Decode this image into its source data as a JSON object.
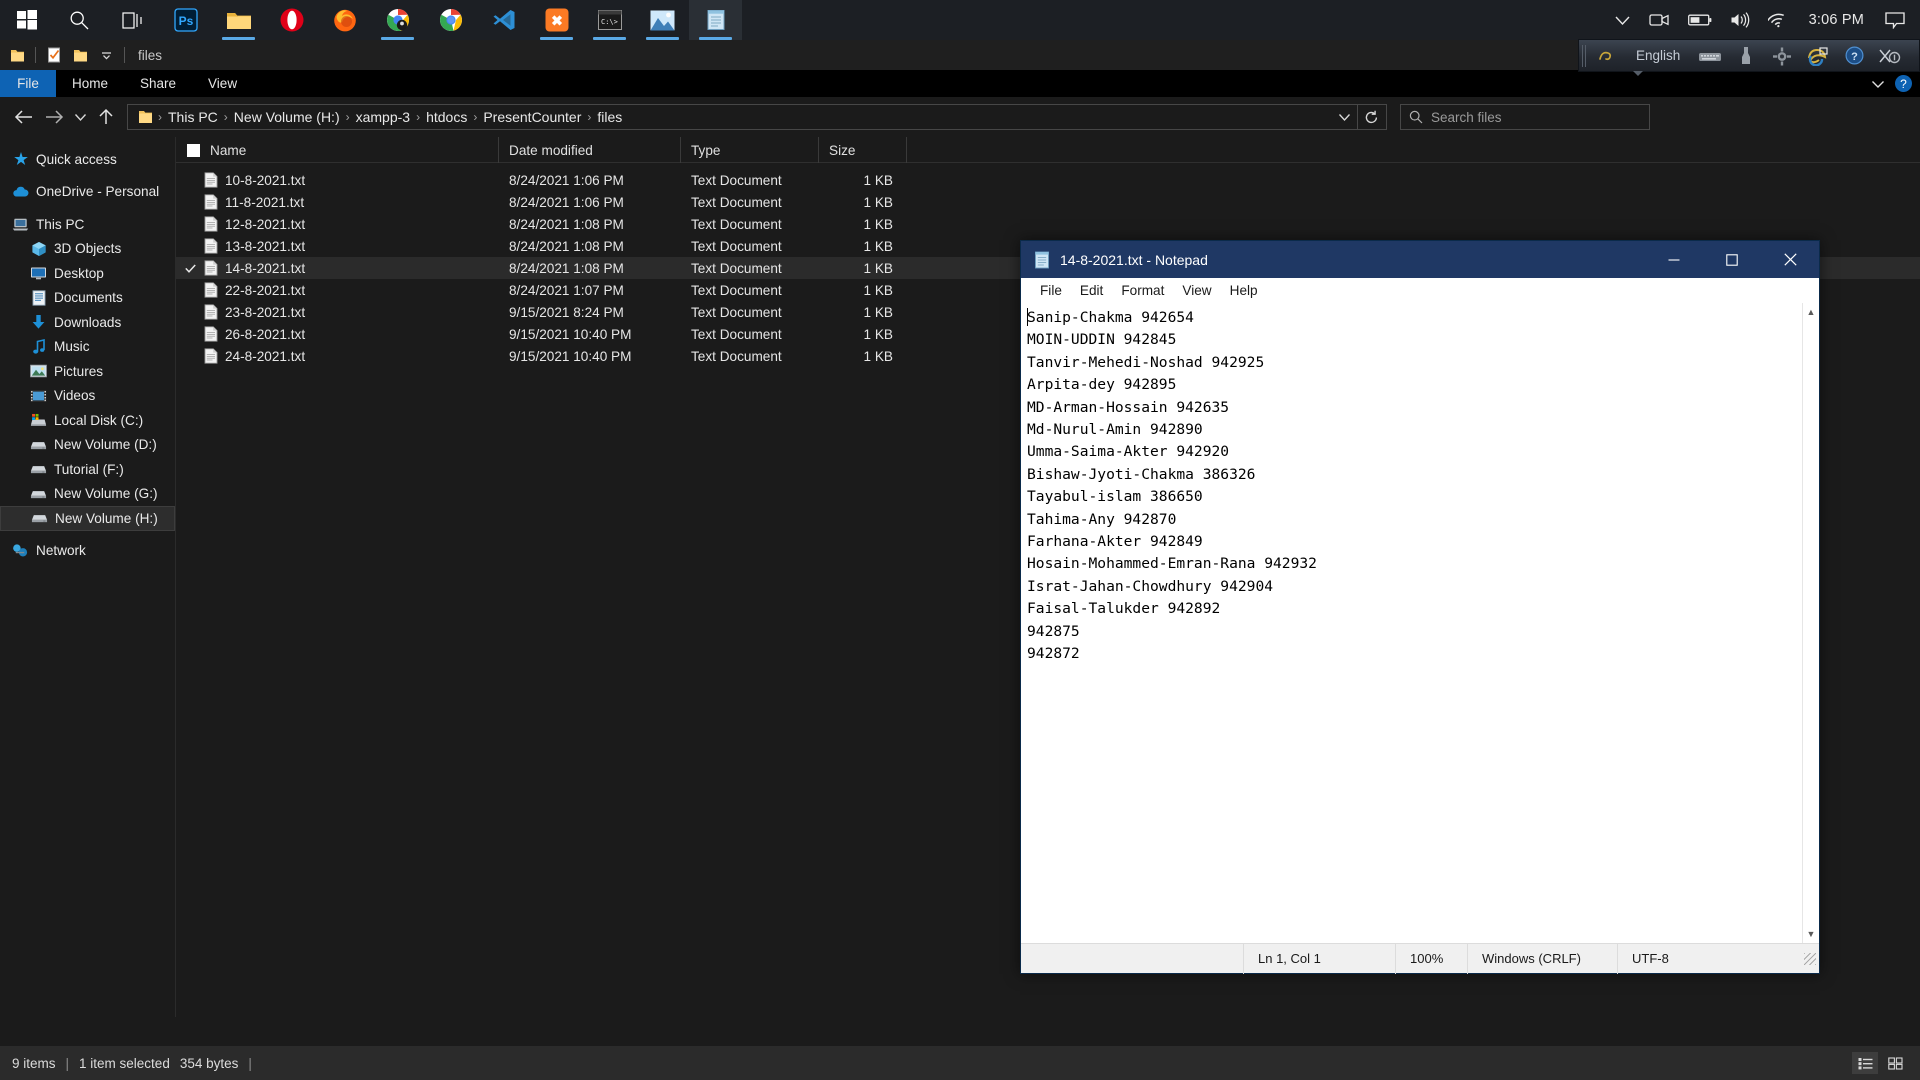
{
  "taskbar": {
    "items": [
      {
        "name": "start-button",
        "icon": "windows-logo-icon",
        "label": "Start",
        "active": false,
        "underline": false
      },
      {
        "name": "search-button",
        "icon": "search-icon",
        "label": "Search",
        "active": false,
        "underline": false
      },
      {
        "name": "task-view-button",
        "icon": "task-view-icon",
        "label": "Task View",
        "active": false,
        "underline": false
      },
      {
        "name": "taskbar-photoshop",
        "icon": "photoshop-icon",
        "label": "Adobe Photoshop",
        "active": false,
        "underline": false
      },
      {
        "name": "taskbar-file-explorer",
        "icon": "folder-icon",
        "label": "File Explorer",
        "active": false,
        "underline": true
      },
      {
        "name": "taskbar-opera",
        "icon": "opera-icon",
        "label": "Opera",
        "active": false,
        "underline": false
      },
      {
        "name": "taskbar-firefox",
        "icon": "firefox-icon",
        "label": "Mozilla Firefox",
        "active": false,
        "underline": false
      },
      {
        "name": "taskbar-chrome-beta",
        "icon": "chrome-beta-icon",
        "label": "Chrome Beta",
        "active": false,
        "underline": true
      },
      {
        "name": "taskbar-chrome",
        "icon": "chrome-icon",
        "label": "Google Chrome",
        "active": false,
        "underline": false
      },
      {
        "name": "taskbar-vscode",
        "icon": "vscode-icon",
        "label": "Visual Studio Code",
        "active": false,
        "underline": false
      },
      {
        "name": "taskbar-xampp",
        "icon": "xampp-icon",
        "label": "XAMPP",
        "active": false,
        "underline": true
      },
      {
        "name": "taskbar-terminal",
        "icon": "terminal-icon",
        "label": "Command Prompt",
        "active": false,
        "underline": true
      },
      {
        "name": "taskbar-photos",
        "icon": "photos-icon",
        "label": "Photos",
        "active": false,
        "underline": true
      },
      {
        "name": "taskbar-notepad",
        "icon": "notepad-icon",
        "label": "Notepad",
        "active": true,
        "underline": true
      }
    ],
    "tray": {
      "chevron": "show-hidden-icons",
      "meet_now": "meet-now-icon",
      "battery": "battery-icon",
      "volume": "volume-icon",
      "network": "wifi-icon",
      "clock": "3:06 PM",
      "action_center": "notifications-icon"
    }
  },
  "language_bar": {
    "logo": "avro-logo-icon",
    "language": "English",
    "buttons": [
      "keyboard-layout-icon",
      "ime-tool-icon",
      "settings-gear-icon",
      "internet-explorer-icon",
      "help-icon",
      "close-icon"
    ]
  },
  "explorer": {
    "quick_access_toolbar": {
      "title": "files",
      "buttons": [
        "folder-icon",
        "properties-icon",
        "new-folder-icon",
        "customize-dropdown-icon"
      ]
    },
    "ribbon_tabs": [
      {
        "label": "File",
        "active": true
      },
      {
        "label": "Home",
        "active": false
      },
      {
        "label": "Share",
        "active": false
      },
      {
        "label": "View",
        "active": false
      }
    ],
    "ribbon_right": {
      "collapse": "chevron-down-icon",
      "help": "?"
    },
    "address_bar": {
      "back": "back-arrow-icon",
      "forward": "forward-arrow-icon",
      "recent": "chevron-down-icon",
      "up": "up-arrow-icon",
      "folder_icon": "folder-icon",
      "breadcrumbs": [
        "This PC",
        "New Volume (H:)",
        "xampp-3",
        "htdocs",
        "PresentCounter",
        "files"
      ],
      "separator": "›",
      "dropdown": "chevron-down-icon",
      "refresh": "refresh-icon"
    },
    "search": {
      "icon": "search-icon",
      "placeholder": "Search files",
      "value": ""
    },
    "nav_pane": [
      {
        "label": "Quick access",
        "icon": "star-icon",
        "indent": false,
        "gap": false,
        "selected": false
      },
      {
        "label": "OneDrive - Personal",
        "icon": "onedrive-icon",
        "indent": false,
        "gap": true,
        "selected": false
      },
      {
        "label": "This PC",
        "icon": "this-pc-icon",
        "indent": false,
        "gap": true,
        "selected": false
      },
      {
        "label": "3D Objects",
        "icon": "3d-objects-icon",
        "indent": true,
        "gap": false,
        "selected": false
      },
      {
        "label": "Desktop",
        "icon": "desktop-icon",
        "indent": true,
        "gap": false,
        "selected": false
      },
      {
        "label": "Documents",
        "icon": "documents-icon",
        "indent": true,
        "gap": false,
        "selected": false
      },
      {
        "label": "Downloads",
        "icon": "downloads-icon",
        "indent": true,
        "gap": false,
        "selected": false
      },
      {
        "label": "Music",
        "icon": "music-icon",
        "indent": true,
        "gap": false,
        "selected": false
      },
      {
        "label": "Pictures",
        "icon": "pictures-icon",
        "indent": true,
        "gap": false,
        "selected": false
      },
      {
        "label": "Videos",
        "icon": "videos-icon",
        "indent": true,
        "gap": false,
        "selected": false
      },
      {
        "label": "Local Disk (C:)",
        "icon": "system-drive-icon",
        "indent": true,
        "gap": false,
        "selected": false
      },
      {
        "label": "New Volume (D:)",
        "icon": "drive-icon",
        "indent": true,
        "gap": false,
        "selected": false
      },
      {
        "label": "Tutorial (F:)",
        "icon": "drive-icon",
        "indent": true,
        "gap": false,
        "selected": false
      },
      {
        "label": "New Volume (G:)",
        "icon": "drive-icon",
        "indent": true,
        "gap": false,
        "selected": false
      },
      {
        "label": "New Volume (H:)",
        "icon": "drive-icon",
        "indent": true,
        "gap": false,
        "selected": true
      },
      {
        "label": "Network",
        "icon": "network-icon",
        "indent": false,
        "gap": true,
        "selected": false
      }
    ],
    "columns": [
      "Name",
      "Date modified",
      "Type",
      "Size"
    ],
    "files": [
      {
        "name": "10-8-2021.txt",
        "date": "8/24/2021 1:06 PM",
        "type": "Text Document",
        "size": "1 KB",
        "selected": false
      },
      {
        "name": "11-8-2021.txt",
        "date": "8/24/2021 1:06 PM",
        "type": "Text Document",
        "size": "1 KB",
        "selected": false
      },
      {
        "name": "12-8-2021.txt",
        "date": "8/24/2021 1:08 PM",
        "type": "Text Document",
        "size": "1 KB",
        "selected": false
      },
      {
        "name": "13-8-2021.txt",
        "date": "8/24/2021 1:08 PM",
        "type": "Text Document",
        "size": "1 KB",
        "selected": false
      },
      {
        "name": "14-8-2021.txt",
        "date": "8/24/2021 1:08 PM",
        "type": "Text Document",
        "size": "1 KB",
        "selected": true
      },
      {
        "name": "22-8-2021.txt",
        "date": "8/24/2021 1:07 PM",
        "type": "Text Document",
        "size": "1 KB",
        "selected": false
      },
      {
        "name": "23-8-2021.txt",
        "date": "9/15/2021 8:24 PM",
        "type": "Text Document",
        "size": "1 KB",
        "selected": false
      },
      {
        "name": "26-8-2021.txt",
        "date": "9/15/2021 10:40 PM",
        "type": "Text Document",
        "size": "1 KB",
        "selected": false
      },
      {
        "name": "24-8-2021.txt",
        "date": "9/15/2021 10:40 PM",
        "type": "Text Document",
        "size": "1 KB",
        "selected": false
      }
    ],
    "status_bar": {
      "item_count": "9 items",
      "selection": "1 item selected",
      "selection_size": "354 bytes",
      "views": [
        {
          "name": "details-view-button",
          "icon": "details-view-icon",
          "active": true
        },
        {
          "name": "large-icons-view-button",
          "icon": "large-icons-view-icon",
          "active": false
        }
      ]
    }
  },
  "notepad": {
    "title": "14-8-2021.txt - Notepad",
    "icon": "notepad-icon",
    "window_buttons": [
      {
        "name": "minimize-button",
        "glyph": "─"
      },
      {
        "name": "maximize-button",
        "glyph": "☐"
      },
      {
        "name": "close-button",
        "glyph": "✕"
      }
    ],
    "menu": [
      "File",
      "Edit",
      "Format",
      "View",
      "Help"
    ],
    "content": "Sanip-Chakma 942654\nMOIN-UDDIN 942845\nTanvir-Mehedi-Noshad 942925\nArpita-dey 942895\nMD-Arman-Hossain 942635\nMd-Nurul-Amin 942890\nUmma-Saima-Akter 942920\nBishaw-Jyoti-Chakma 386326\nTayabul-islam 386650\nTahima-Any 942870\nFarhana-Akter 942849\nHosain-Mohammed-Emran-Rana 942932\nIsrat-Jahan-Chowdhury 942904\nFaisal-Talukder 942892\n942875\n942872",
    "status_bar": {
      "position": "Ln 1, Col 1",
      "zoom": "100%",
      "line_ending": "Windows (CRLF)",
      "encoding": "UTF-8"
    },
    "scrollbar": {
      "up": "▲",
      "down": "▼"
    }
  },
  "colors": {
    "taskbar_bg": "#1c1f24",
    "explorer_bg": "#1b1b1b",
    "accent_blue": "#0e63b4",
    "selection_bg": "#2b2b2b",
    "notepad_title_bg": "#1f3864",
    "status_bg": "#2b2b2b"
  }
}
